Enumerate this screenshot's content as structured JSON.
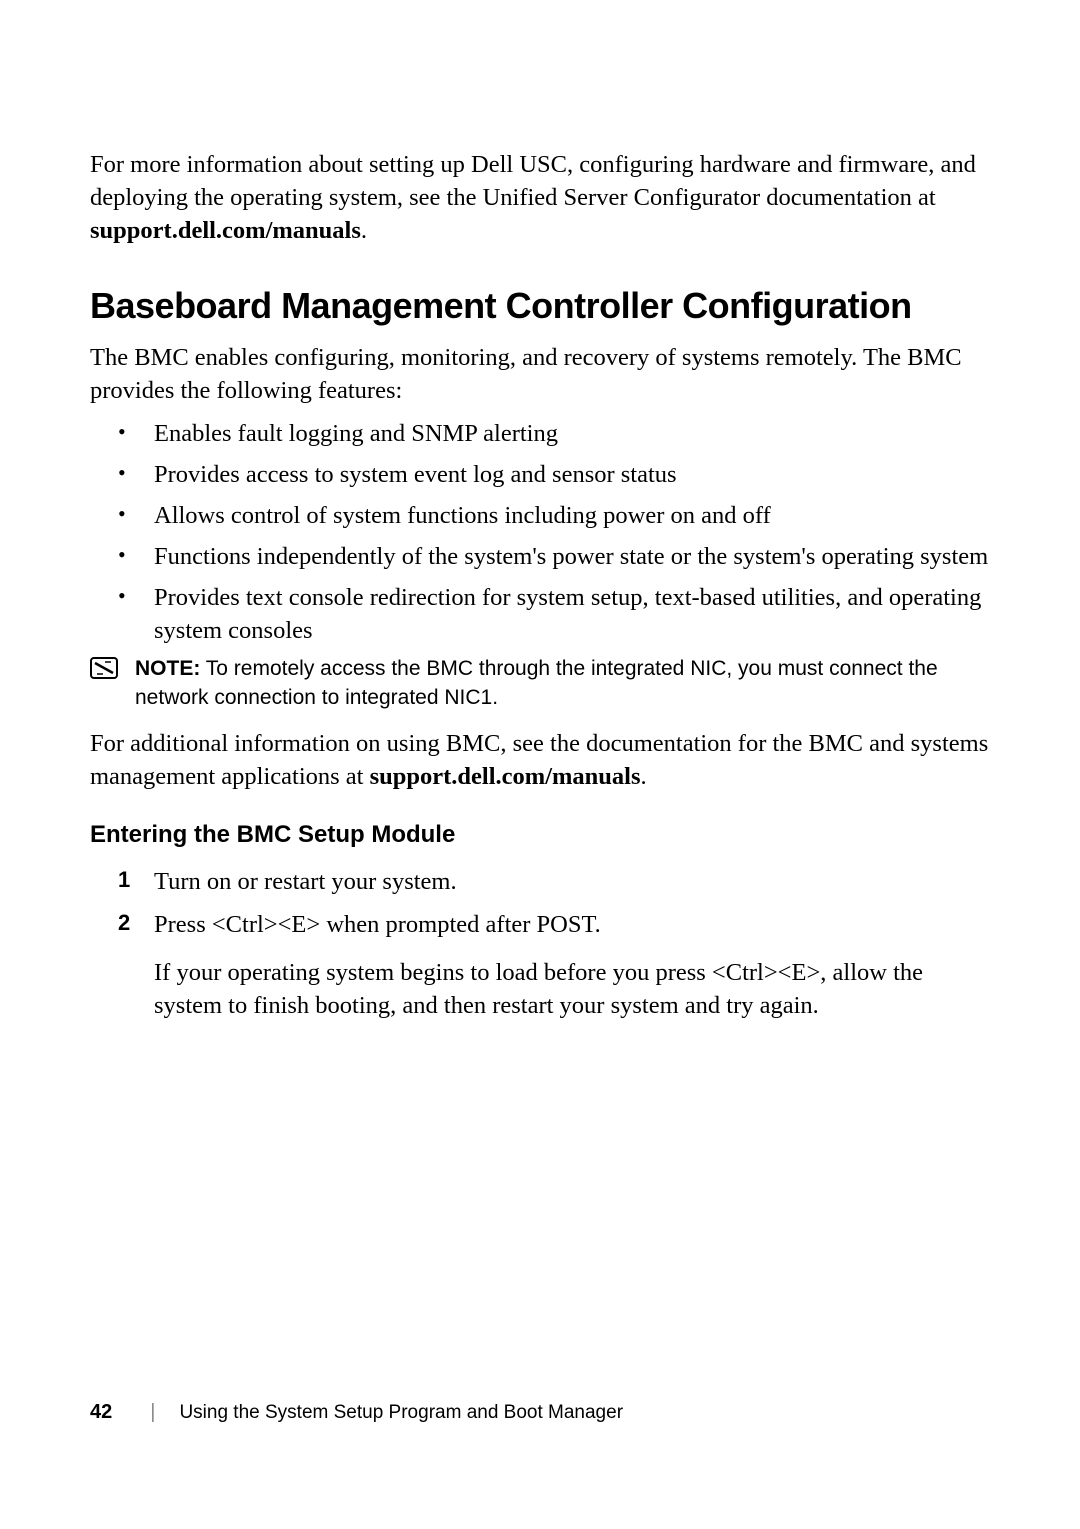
{
  "intro": {
    "text_prefix": "For more information about setting up Dell USC, configuring hardware and firmware, and deploying the operating system, see the Unified Server Configurator documentation at ",
    "bold": "support.dell.com/manuals",
    "suffix": "."
  },
  "heading": "Baseboard Management Controller Configuration",
  "para1": "The BMC enables configuring, monitoring, and recovery of systems remotely. The BMC provides the following features:",
  "bullets": [
    "Enables fault logging and SNMP alerting",
    "Provides access to system event log and sensor status",
    "Allows control of system functions including power on and off",
    "Functions independently of the system's power state or the system's operating system",
    "Provides text console redirection for system setup, text-based utilities, and operating system consoles"
  ],
  "note": {
    "label": "NOTE:",
    "text": " To remotely access the BMC through the integrated NIC, you must connect the network connection to integrated NIC1."
  },
  "para2": {
    "prefix": "For additional information on using BMC, see the documentation for the BMC and systems management applications at ",
    "bold": "support.dell.com/manuals",
    "suffix": "."
  },
  "subheading": "Entering the BMC Setup Module",
  "steps": [
    {
      "num": "1",
      "text": "Turn on or restart your system."
    },
    {
      "num": "2",
      "text": "Press <Ctrl><E> when prompted after POST.",
      "sub": "If your operating system begins to load before you press <Ctrl><E>, allow the system to finish booting, and then restart your system and try again."
    }
  ],
  "footer": {
    "page": "42",
    "title": "Using the System Setup Program and Boot Manager"
  }
}
